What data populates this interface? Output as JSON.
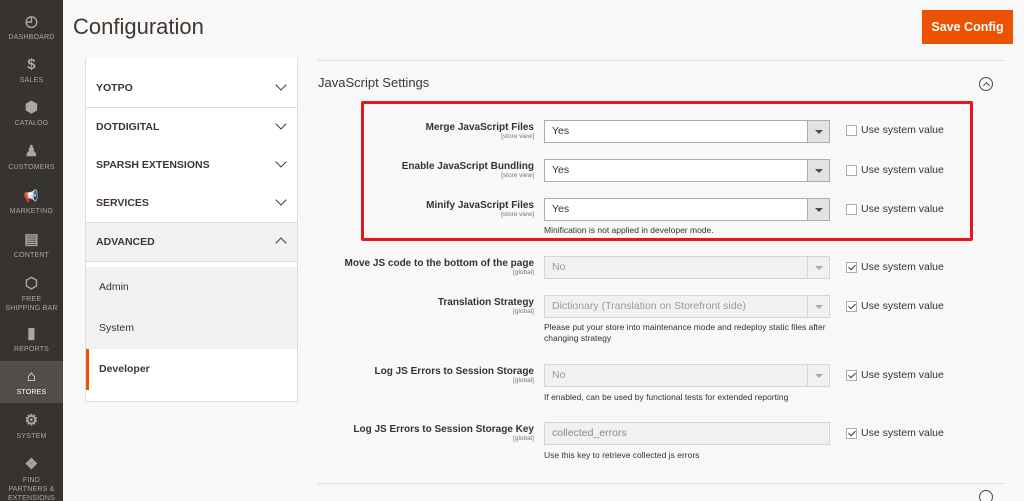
{
  "nav": {
    "items": [
      {
        "label": "DASHBOARD",
        "icon": "dashboard-icon",
        "glyph": "◴"
      },
      {
        "label": "SALES",
        "icon": "dollar-icon",
        "glyph": "$"
      },
      {
        "label": "CATALOG",
        "icon": "box-icon",
        "glyph": "⬢"
      },
      {
        "label": "CUSTOMERS",
        "icon": "person-icon",
        "glyph": "♟"
      },
      {
        "label": "MARKETING",
        "icon": "megaphone-icon",
        "glyph": "📢"
      },
      {
        "label": "CONTENT",
        "icon": "layout-icon",
        "glyph": "▤"
      },
      {
        "label": "FREE SHIPPING BAR",
        "icon": "hexagon-icon",
        "glyph": "⬡"
      },
      {
        "label": "REPORTS",
        "icon": "bar-chart-icon",
        "glyph": "▮"
      },
      {
        "label": "STORES",
        "icon": "store-icon",
        "glyph": "⌂"
      },
      {
        "label": "SYSTEM",
        "icon": "gear-icon",
        "glyph": "⚙"
      },
      {
        "label": "FIND PARTNERS & EXTENSIONS",
        "icon": "blocks-icon",
        "glyph": "❖"
      }
    ]
  },
  "header": {
    "title": "Configuration",
    "save_label": "Save Config"
  },
  "sidebar": {
    "sections": [
      "YOTPO",
      "DOTDIGITAL",
      "SPARSH EXTENSIONS",
      "SERVICES",
      "ADVANCED"
    ],
    "items": [
      "Admin",
      "System",
      "Developer"
    ]
  },
  "section": {
    "title": "JavaScript Settings"
  },
  "system_value_label": "Use system value",
  "rows": [
    {
      "label": "Merge JavaScript Files",
      "scope": "[store view]",
      "value": "Yes",
      "system": false
    },
    {
      "label": "Enable JavaScript Bundling",
      "scope": "[store view]",
      "value": "Yes",
      "system": false
    },
    {
      "label": "Minify JavaScript Files",
      "scope": "[store view]",
      "value": "Yes",
      "system": false,
      "note": "Minification is not applied in developer mode."
    },
    {
      "label": "Move JS code to the bottom of the page",
      "scope": "[global]",
      "value": "No",
      "system": true
    },
    {
      "label": "Translation Strategy",
      "scope": "[global]",
      "value": "Dictionary (Translation on Storefront side)",
      "system": true,
      "note": "Please put your store into maintenance mode and redeploy static files after changing strategy"
    },
    {
      "label": "Log JS Errors to Session Storage",
      "scope": "[global]",
      "value": "No",
      "system": true,
      "note": "If enabled, can be used by functional tests for extended reporting"
    },
    {
      "label": "Log JS Errors to Session Storage Key",
      "scope": "[global]",
      "value": "collected_errors",
      "system": true,
      "note": "Use this key to retrieve collected js errors"
    }
  ],
  "colors": {
    "accent": "#eb5202",
    "highlight": "#e8151b",
    "nav_bg": "#373330"
  }
}
